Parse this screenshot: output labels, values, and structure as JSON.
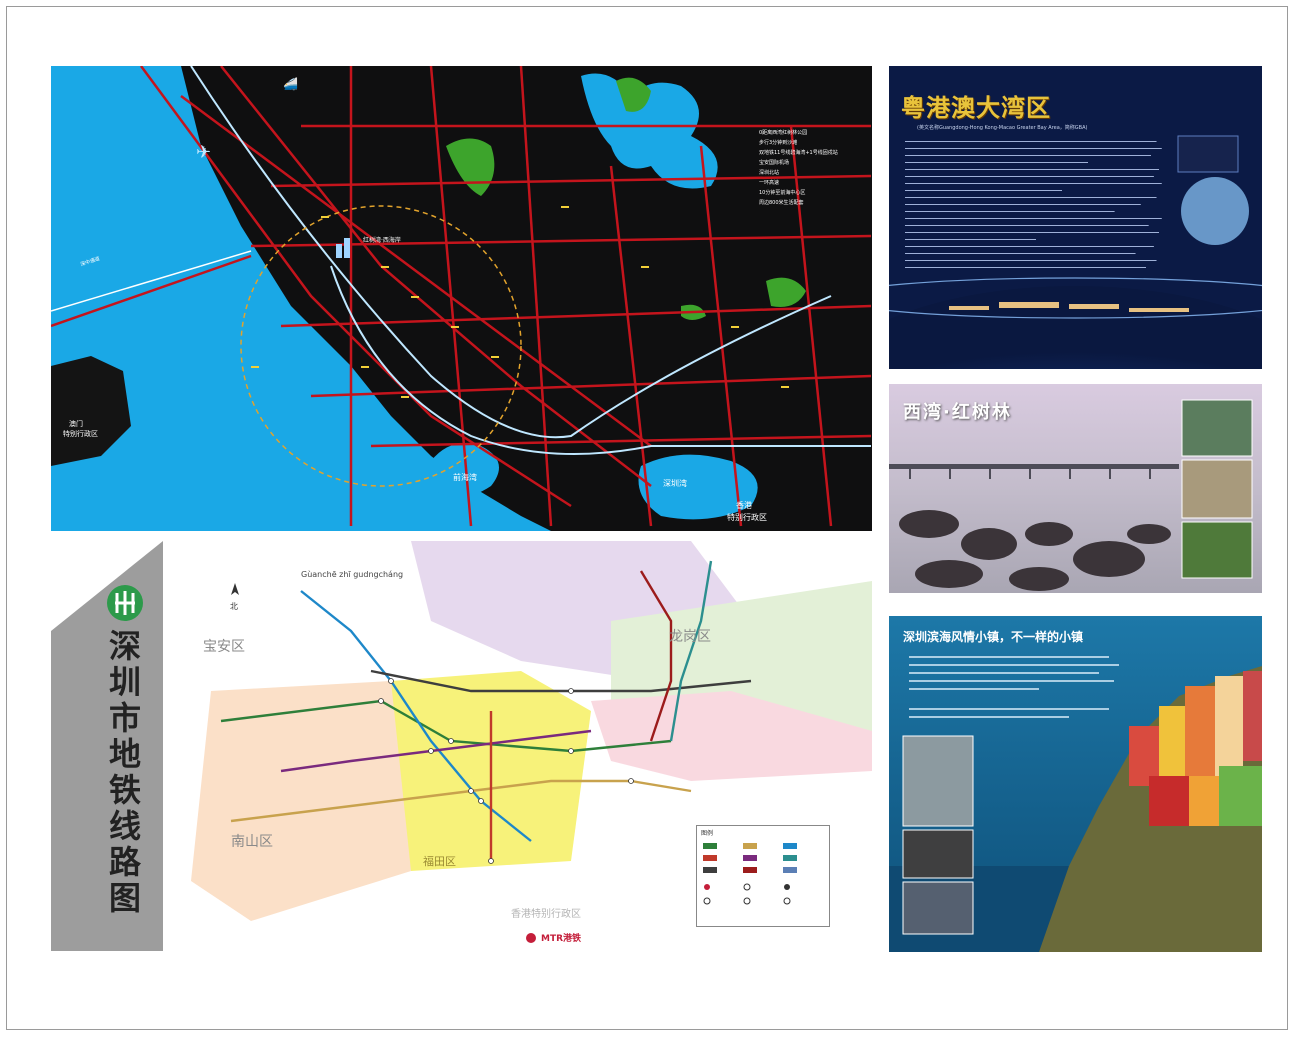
{
  "map": {
    "region_macau": "澳门",
    "region_macau_2": "特别行政区",
    "bay_qianhai": "前海湾",
    "bay_shenzhen": "深圳湾",
    "region_hk": "香港",
    "region_hk_2": "特别行政区",
    "project_label": "红树湾·西海岸",
    "bridge_label": "深中通道",
    "features": [
      "0距离西湾红树林公园",
      "步行3分钟到沙滩",
      "双地铁11号线碧海湾+1号线固戍站",
      "宝安国际机场",
      "深圳北站",
      "一环高速",
      "10分钟至前海中心区",
      "周边800米生活配套"
    ]
  },
  "bay": {
    "title": "粤港澳大湾区",
    "subtitle": "(英文名称Guangdong-Hong Kong-Macao Greater Bay Area，简称GBA)"
  },
  "mangrove": {
    "title": "西湾·红树林"
  },
  "town": {
    "title": "深圳滨海风情小镇，不一样的小镇"
  },
  "metro": {
    "title_chars": [
      "深",
      "圳",
      "市",
      "地",
      "铁",
      "线",
      "路",
      "图"
    ],
    "north": "北",
    "pinyin_top": "Gùanchē zhī gudngcháng",
    "district_baoan": "宝安区",
    "district_longgang": "龙岗区",
    "district_nanshan": "南山区",
    "district_futian": "福田区",
    "region_hk": "香港特别行政区",
    "mtr_label": "MTR港铁",
    "legend_title": "图例"
  },
  "colors": {
    "map_bg": "#111111",
    "water": "#1aa8e6",
    "road": "#c4141c",
    "metro_line": "#bfe7ff",
    "park": "#3da42c",
    "bay_title": "#e8c33b"
  }
}
